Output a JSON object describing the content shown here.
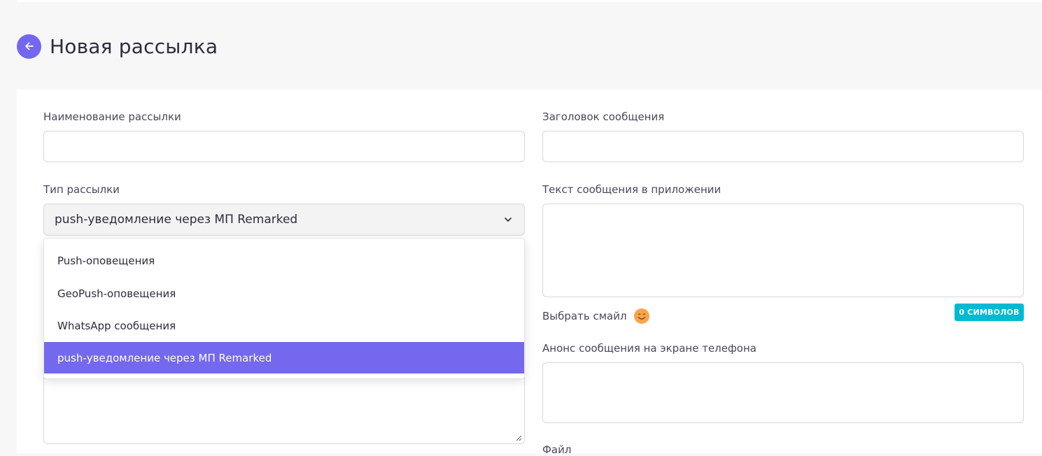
{
  "header": {
    "title": "Новая рассылка"
  },
  "form": {
    "name_label": "Наименование рассылки",
    "name_value": "",
    "type_label": "Тип рассылки",
    "type_selected": "push-уведомление через МП Remarked",
    "type_options": [
      "Push-оповещения",
      "GeoPush-оповещения",
      "WhatsApp сообщения",
      "push-уведомление через МП Remarked"
    ],
    "subject_label": "Заголовок сообщения",
    "subject_value": "",
    "app_text_label": "Текст сообщения в приложении",
    "app_text_value": "",
    "emoji_label": "Выбрать смайл",
    "char_count": "0 СИМВОЛОВ",
    "preview_label": "Анонс сообщения на экране телефона",
    "preview_value": "",
    "file_label": "Файл"
  },
  "colors": {
    "accent": "#7367f0",
    "badge": "#00bad1",
    "emoji": "#f7a64a"
  },
  "icons": {
    "back": "arrow-left-icon",
    "select": "chevron-down-icon",
    "emoji": "smiley-icon"
  }
}
